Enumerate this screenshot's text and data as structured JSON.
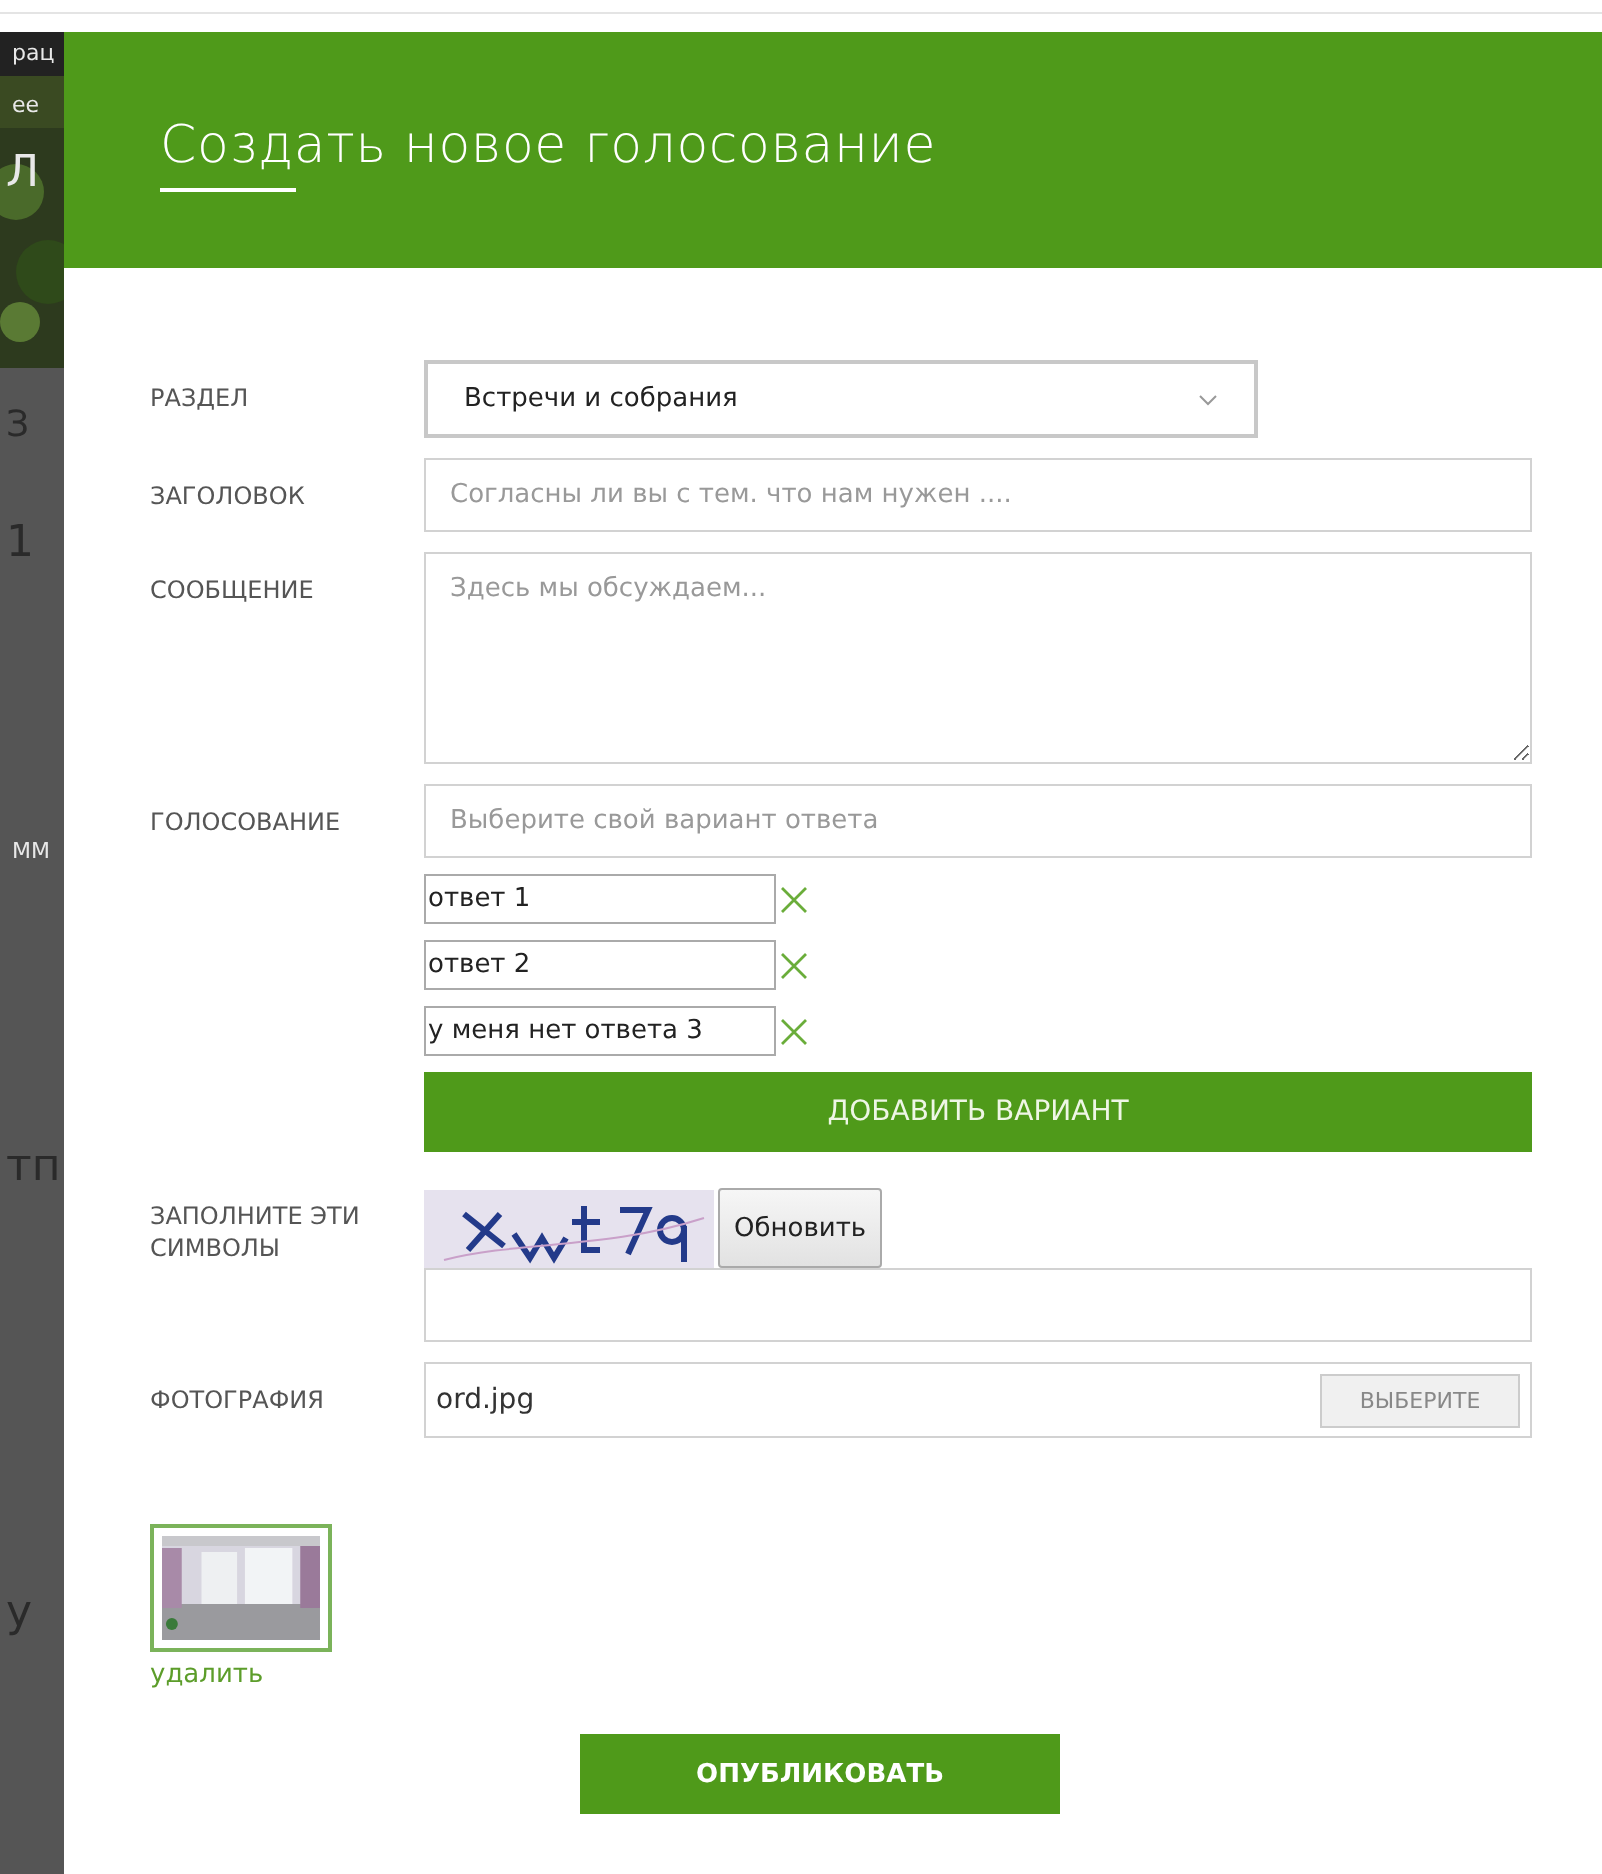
{
  "background_fragments": [
    {
      "text": "рац",
      "kind": "small"
    },
    {
      "text": "ее",
      "kind": "small"
    },
    {
      "text": "Л",
      "kind": "light"
    },
    {
      "text": "З",
      "kind": "medium"
    },
    {
      "text": "1",
      "kind": "large"
    },
    {
      "text": "ММ",
      "kind": "small"
    },
    {
      "text": "тп",
      "kind": "large"
    },
    {
      "text": "у",
      "kind": "large"
    }
  ],
  "dialog": {
    "title": "Создать новое голосование",
    "section": {
      "label": "РАЗДЕЛ",
      "value": "Встречи и собрания"
    },
    "heading": {
      "label": "ЗАГОЛОВОК",
      "placeholder": "Согласны ли вы с тем. что нам нужен ...."
    },
    "message": {
      "label": "СООБЩЕНИЕ",
      "placeholder": "Здесь мы обсуждаем..."
    },
    "vote": {
      "label": "ГОЛОСОВАНИЕ",
      "placeholder": "Выберите свой вариант ответа",
      "answers": [
        {
          "value": "ответ 1"
        },
        {
          "value": "ответ 2"
        },
        {
          "value": "у меня нет ответа 3"
        }
      ],
      "add_button": "ДОБАВИТЬ ВАРИАНТ"
    },
    "captcha": {
      "label": "ЗАПОЛНИТЕ ЭТИ СИМВОЛЫ",
      "refresh_button": "Обновить"
    },
    "photo": {
      "label": "ФОТОГРАФИЯ",
      "value": "ord.jpg",
      "choose_button": "ВЫБЕРИТЕ",
      "delete_link": "удалить"
    },
    "publish_button": "ОПУБЛИКОВАТЬ"
  }
}
